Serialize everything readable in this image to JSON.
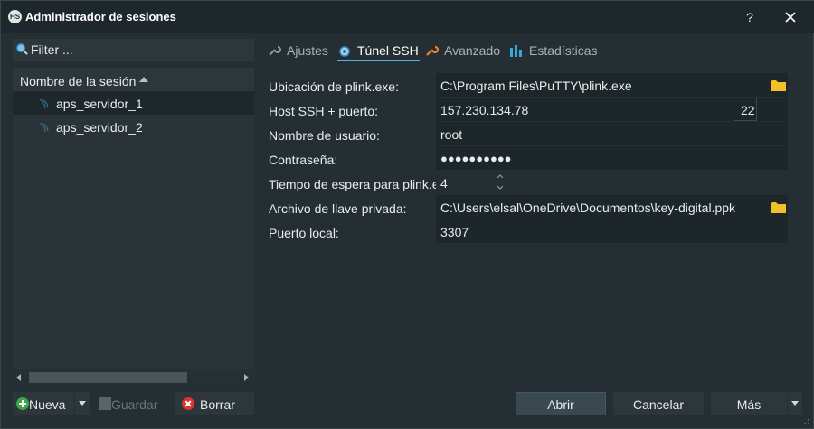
{
  "window": {
    "title": "Administrador de sesiones",
    "help": "?",
    "logo_text": "HS"
  },
  "sidebar": {
    "filter_placeholder": "Filter ...",
    "column_header": "Nombre de la sesión",
    "sessions": [
      "aps_servidor_1",
      "aps_servidor_2"
    ],
    "selected_index": 0
  },
  "tabs": [
    {
      "label": "Ajustes",
      "icon": "wrench-icon"
    },
    {
      "label": "Túnel SSH",
      "icon": "ssh-tunnel-icon",
      "active": true
    },
    {
      "label": "Avanzado",
      "icon": "wrench-orange-icon"
    },
    {
      "label": "Estadísticas",
      "icon": "bar-chart-icon"
    }
  ],
  "form": {
    "plink_label": "Ubicación de plink.exe:",
    "plink_value": "C:\\Program Files\\PuTTY\\plink.exe",
    "host_label": "Host SSH + puerto:",
    "host_value": "157.230.134.78",
    "port_value": "22",
    "user_label": "Nombre de usuario:",
    "user_value": "root",
    "password_label": "Contraseña:",
    "password_value": "●●●●●●●●●●",
    "timeout_label": "Tiempo de espera para plink.ex",
    "timeout_value": "4",
    "keyfile_label": "Archivo de llave privada:",
    "keyfile_value": "C:\\Users\\elsal\\OneDrive\\Documentos\\key-digital.ppk",
    "localport_label": "Puerto local:",
    "localport_value": "3307"
  },
  "buttons": {
    "nueva": "Nueva",
    "guardar": "Guardar",
    "borrar": "Borrar",
    "abrir": "Abrir",
    "cancelar": "Cancelar",
    "mas": "Más"
  },
  "colors": {
    "accent": "#5aaee0",
    "background": "#252f33",
    "field": "#1d2629"
  }
}
